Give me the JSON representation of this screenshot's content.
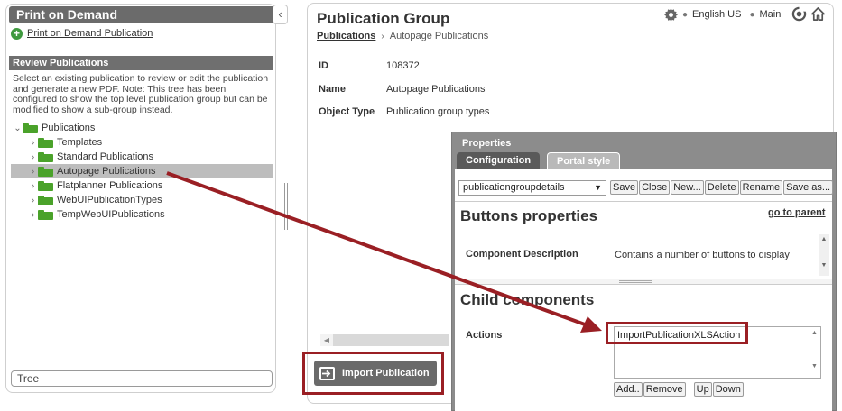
{
  "left": {
    "header": "Print on Demand",
    "collapse_glyph": "‹",
    "pod_link": "Print on Demand Publication",
    "review_header": "Review Publications",
    "review_desc": "Select an existing publication to review or edit the publication and generate a new PDF. Note: This tree has been configured to show the top level publication group but can be modified to show a sub-group instead.",
    "tree_root": "Publications",
    "tree_items": [
      "Templates",
      "Standard Publications",
      "Autopage Publications",
      "Flatplanner Publications",
      "WebUIPublicationTypes",
      "TempWebUIPublications"
    ],
    "selected_item": "Autopage Publications",
    "footer": "Tree"
  },
  "main": {
    "title": "Publication Group",
    "breadcrumb": [
      "Publications",
      "Autopage Publications"
    ],
    "language": "English US",
    "context": "Main",
    "props": [
      {
        "label": "ID",
        "value": "108372"
      },
      {
        "label": "Name",
        "value": "Autopage Publications"
      },
      {
        "label": "Object Type",
        "value": "Publication group types"
      }
    ],
    "import_button": "Import Publication"
  },
  "properties": {
    "title": "Properties",
    "tabs": [
      "Configuration",
      "Portal style"
    ],
    "component_select": "publicationgroupdetails",
    "toolbar_buttons": [
      "Save",
      "Close",
      "New...",
      "Delete",
      "Rename",
      "Save as..."
    ],
    "buttons_heading": "Buttons properties",
    "goto_parent": "go to parent",
    "component_description_label": "Component Description",
    "component_description_value": "Contains a number of buttons to display",
    "child_heading": "Child components",
    "actions_label": "Actions",
    "actions_items": [
      "ImportPublicationXLSAction"
    ],
    "list_buttons": [
      "Add..",
      "Remove",
      "Up",
      "Down"
    ]
  },
  "colors": {
    "annotation": "#9a1f24",
    "folder": "#4aa22a",
    "header": "#6b6b6b"
  },
  "icons": [
    "plus-icon",
    "folder-icon",
    "chevron-right-icon",
    "chevron-down-icon",
    "gear-icon",
    "refresh-icon",
    "home-icon",
    "import-icon",
    "dropdown-arrow-icon"
  ]
}
